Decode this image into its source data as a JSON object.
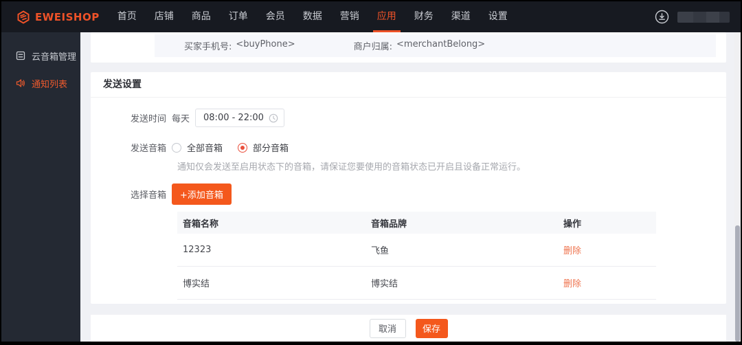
{
  "topbar": {
    "logo_text": "EWEISHOP",
    "menu": [
      "首页",
      "店铺",
      "商品",
      "订单",
      "会员",
      "数据",
      "营销",
      "应用",
      "财务",
      "渠道",
      "设置"
    ],
    "active_item": "应用"
  },
  "sidebar": {
    "items": [
      {
        "label": "云音箱管理",
        "icon": "form-icon",
        "active": false
      },
      {
        "label": "通知列表",
        "icon": "speaker-icon",
        "active": true
      }
    ]
  },
  "notice_fields": {
    "buyer_phone_label": "买家手机号:",
    "buyer_phone_value": "<buyPhone>",
    "merchant_label": "商户归属:",
    "merchant_value": "<merchantBelong>"
  },
  "send_settings": {
    "title": "发送设置",
    "send_time": {
      "label": "发送时间",
      "prefix": "每天",
      "value": "08:00 - 22:00"
    },
    "send_speaker": {
      "label": "发送音箱",
      "option_all": "全部音箱",
      "option_partial": "部分音箱",
      "selected": "部分音箱",
      "help": "通知仅会发送至启用状态下的音箱，请保证您要使用的音箱状态已开启且设备正常运行。"
    },
    "select_speaker": {
      "label": "选择音箱",
      "add_button": "+添加音箱"
    },
    "table": {
      "headers": [
        "音箱名称",
        "音箱品牌",
        "操作"
      ],
      "rows": [
        {
          "name": "12323",
          "brand": "飞鱼",
          "action": "删除"
        },
        {
          "name": "博实结",
          "brand": "博实结",
          "action": "删除"
        }
      ]
    }
  },
  "footer": {
    "cancel": "取消",
    "save": "保存"
  },
  "colors": {
    "accent": "#ee5228",
    "button_orange": "#f4581c",
    "delete_link": "#ef7550",
    "nav_bg": "#171a21",
    "sidebar_bg": "#242933",
    "page_bg": "#f0f1f5"
  }
}
